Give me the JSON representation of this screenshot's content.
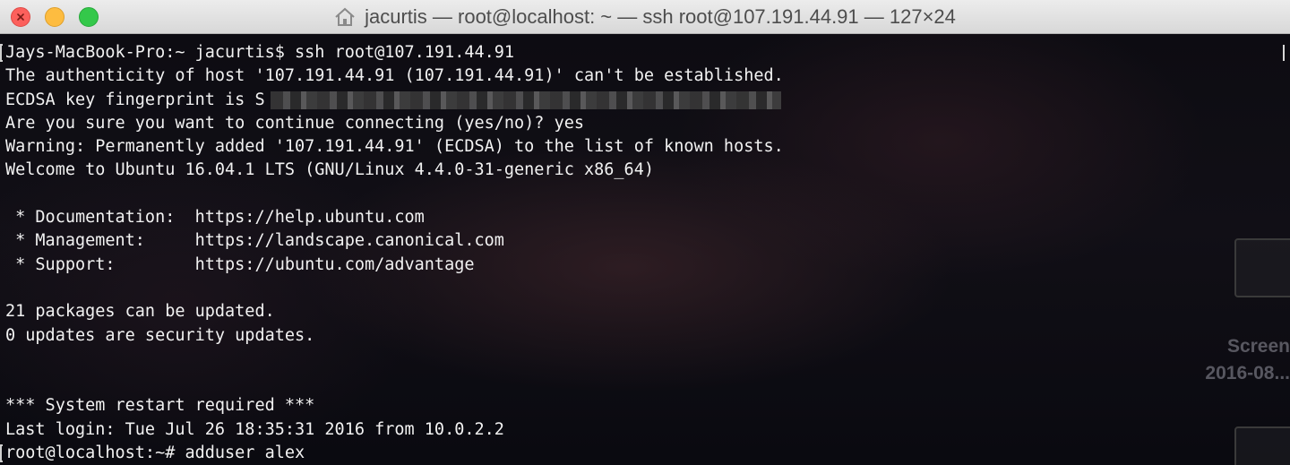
{
  "window": {
    "title": "jacurtis — root@localhost: ~ — ssh root@107.191.44.91 — 127×24"
  },
  "terminal": {
    "lines": [
      "Jays-MacBook-Pro:~ jacurtis$ ssh root@107.191.44.91",
      "The authenticity of host '107.191.44.91 (107.191.44.91)' can't be established.",
      "ECDSA key fingerprint is S",
      "Are you sure you want to continue connecting (yes/no)? yes",
      "Warning: Permanently added '107.191.44.91' (ECDSA) to the list of known hosts.",
      "Welcome to Ubuntu 16.04.1 LTS (GNU/Linux 4.4.0-31-generic x86_64)",
      "",
      " * Documentation:  https://help.ubuntu.com",
      " * Management:     https://landscape.canonical.com",
      " * Support:        https://ubuntu.com/advantage",
      "",
      "21 packages can be updated.",
      "0 updates are security updates.",
      "",
      "",
      "*** System restart required ***",
      "Last login: Tue Jul 26 18:35:31 2016 from 10.0.2.2",
      "root@localhost:~# adduser alex"
    ]
  },
  "desktop": {
    "screenshot_label_line1": "Screen",
    "screenshot_label_line2": "2016-08..."
  },
  "colors": {
    "close": "#fc605c",
    "minimize": "#fdbc40",
    "zoom": "#34c84a",
    "terminal_text": "#f2f2f2"
  }
}
